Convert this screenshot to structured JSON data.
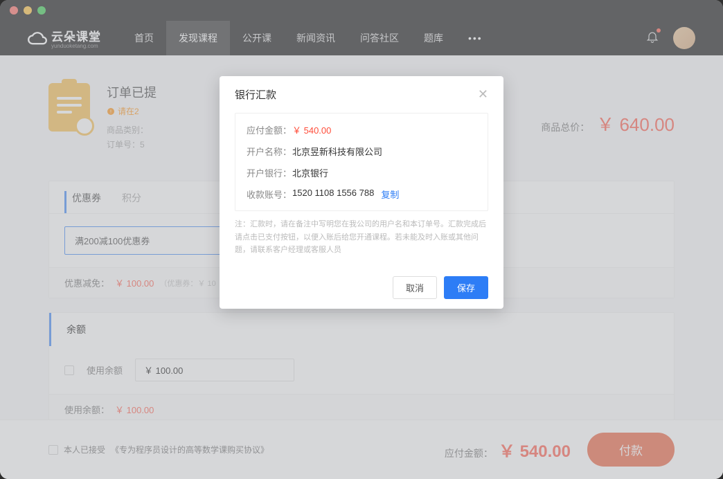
{
  "logo": {
    "main": "云朵课堂",
    "sub": "yunduoketang.com"
  },
  "nav": {
    "items": [
      "首页",
      "发现课程",
      "公开课",
      "新闻资讯",
      "问答社区",
      "题库"
    ],
    "activeIndex": 1
  },
  "order": {
    "title": "订单已提",
    "warn": "请在2",
    "meta1": "商品类别：",
    "meta2": "订单号：5",
    "totalLabel": "商品总价：",
    "totalPrice": "￥ 640.00"
  },
  "coupon": {
    "tab1": "优惠券",
    "tab2": "积分",
    "selected": "满200减100优惠券",
    "discountLabel": "优惠减免：",
    "discountValue": "￥ 100.00",
    "discountSub": "（优惠券：￥ 10"
  },
  "balance": {
    "title": "余额",
    "useLabel": "使用余额",
    "inputValue": "￥ 100.00",
    "usedLabel": "使用余额：",
    "usedValue": "￥ 100.00"
  },
  "footer": {
    "agreePrefix": "本人已接受",
    "agreeLink": "《专为程序员设计的高等数学课购买协议》",
    "payableLabel": "应付金额：",
    "payableValue": "￥ 540.00",
    "payButton": "付款"
  },
  "modal": {
    "title": "银行汇款",
    "amountLabel": "应付金额：",
    "amountValue": "￥ 540.00",
    "holderLabel": "开户名称：",
    "holderValue": "北京昱新科技有限公司",
    "bankLabel": "开户银行：",
    "bankValue": "北京银行",
    "accountLabel": "收款账号：",
    "accountValue": "1520 1108 1556 788",
    "copy": "复制",
    "note": "注：汇款时，请在备注中写明您在我公司的用户名和本订单号。汇款完成后请点击已支付按钮，以便入账后给您开通课程。若未能及时入账或其他问题，请联系客户经理或客服人员",
    "cancel": "取消",
    "save": "保存"
  }
}
